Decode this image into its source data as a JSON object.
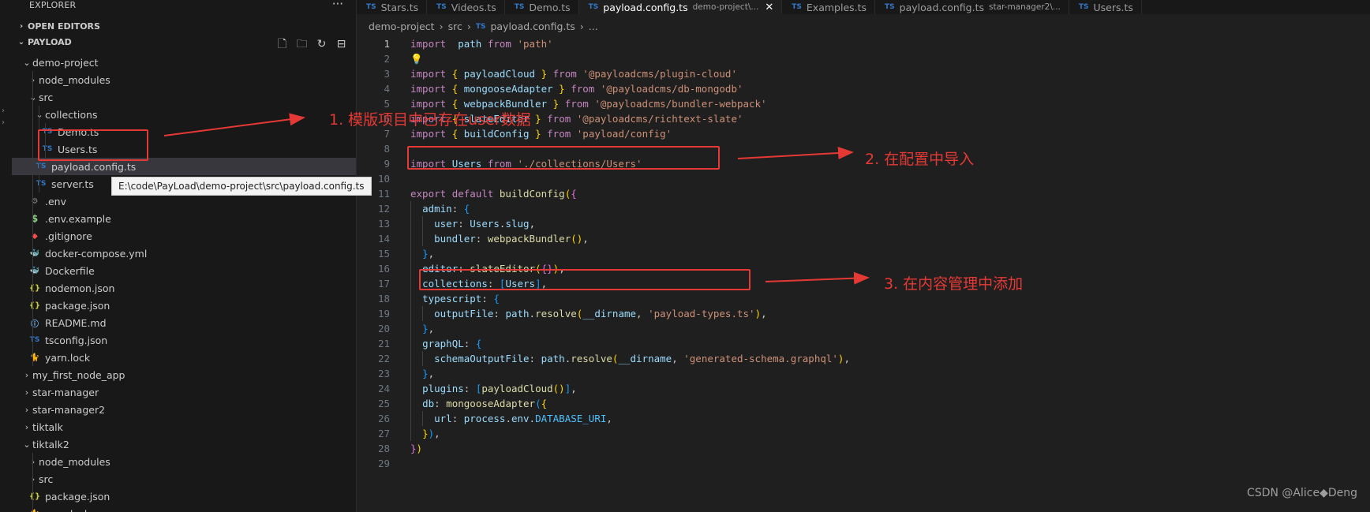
{
  "explorer": {
    "title": "EXPLORER",
    "more": "···",
    "open_editors": "OPEN EDITORS",
    "workspace": "PAYLOAD",
    "actions": [
      "new-file",
      "new-folder",
      "refresh",
      "collapse-all"
    ],
    "tree": [
      {
        "label": "demo-project",
        "type": "folder",
        "open": true,
        "depth": 1
      },
      {
        "label": "node_modules",
        "type": "folder",
        "open": false,
        "depth": 2
      },
      {
        "label": "src",
        "type": "folder",
        "open": true,
        "depth": 2
      },
      {
        "label": "collections",
        "type": "folder",
        "open": true,
        "depth": 3
      },
      {
        "label": "Demo.ts",
        "type": "ts",
        "depth": 4
      },
      {
        "label": "Users.ts",
        "type": "ts",
        "depth": 4
      },
      {
        "label": "payload.config.ts",
        "type": "ts",
        "depth": 3,
        "selected": true
      },
      {
        "label": "server.ts",
        "type": "ts",
        "depth": 3
      },
      {
        "label": ".env",
        "type": "env",
        "depth": 2
      },
      {
        "label": ".env.example",
        "type": "dollar",
        "depth": 2
      },
      {
        "label": ".gitignore",
        "type": "git",
        "depth": 2
      },
      {
        "label": "docker-compose.yml",
        "type": "docker",
        "depth": 2
      },
      {
        "label": "Dockerfile",
        "type": "docker",
        "depth": 2
      },
      {
        "label": "nodemon.json",
        "type": "json",
        "depth": 2
      },
      {
        "label": "package.json",
        "type": "json",
        "depth": 2
      },
      {
        "label": "README.md",
        "type": "info",
        "depth": 2
      },
      {
        "label": "tsconfig.json",
        "type": "ts",
        "depth": 2
      },
      {
        "label": "yarn.lock",
        "type": "yarn",
        "depth": 2
      },
      {
        "label": "my_first_node_app",
        "type": "folder",
        "open": false,
        "depth": 1
      },
      {
        "label": "star-manager",
        "type": "folder",
        "open": false,
        "depth": 1
      },
      {
        "label": "star-manager2",
        "type": "folder",
        "open": false,
        "depth": 1
      },
      {
        "label": "tiktalk",
        "type": "folder",
        "open": false,
        "depth": 1
      },
      {
        "label": "tiktalk2",
        "type": "folder",
        "open": true,
        "depth": 1
      },
      {
        "label": "node_modules",
        "type": "folder",
        "open": false,
        "depth": 2
      },
      {
        "label": "src",
        "type": "folder",
        "open": false,
        "depth": 2
      },
      {
        "label": "package.json",
        "type": "json",
        "depth": 2
      },
      {
        "label": "yarn.lock",
        "type": "yarn",
        "depth": 2
      }
    ],
    "tooltip": "E:\\code\\PayLoad\\demo-project\\src\\payload.config.ts"
  },
  "tabs": [
    {
      "label": "Stars.ts",
      "desc": "",
      "active": false
    },
    {
      "label": "Videos.ts",
      "desc": "",
      "active": false
    },
    {
      "label": "Demo.ts",
      "desc": "",
      "active": false
    },
    {
      "label": "payload.config.ts",
      "desc": "demo-project\\...",
      "active": true
    },
    {
      "label": "Examples.ts",
      "desc": "",
      "active": false
    },
    {
      "label": "payload.config.ts",
      "desc": "star-manager2\\...",
      "active": false
    },
    {
      "label": "Users.ts",
      "desc": "",
      "active": false
    }
  ],
  "breadcrumb": [
    "demo-project",
    "src",
    "payload.config.ts",
    "..."
  ],
  "code": [
    [
      [
        "kw",
        "import"
      ],
      [
        "",
        "  "
      ],
      [
        "var",
        "path"
      ],
      [
        "",
        " "
      ],
      [
        "kw",
        "from"
      ],
      [
        "",
        " "
      ],
      [
        "str",
        "'path'"
      ]
    ],
    [
      [
        "bulb",
        "💡"
      ]
    ],
    [
      [
        "kw",
        "import"
      ],
      [
        "",
        " "
      ],
      [
        "br1",
        "{"
      ],
      [
        "",
        " "
      ],
      [
        "var",
        "payloadCloud"
      ],
      [
        "",
        " "
      ],
      [
        "br1",
        "}"
      ],
      [
        "",
        " "
      ],
      [
        "kw",
        "from"
      ],
      [
        "",
        " "
      ],
      [
        "str",
        "'@payloadcms/plugin-cloud'"
      ]
    ],
    [
      [
        "kw",
        "import"
      ],
      [
        "",
        " "
      ],
      [
        "br1",
        "{"
      ],
      [
        "",
        " "
      ],
      [
        "var",
        "mongooseAdapter"
      ],
      [
        "",
        " "
      ],
      [
        "br1",
        "}"
      ],
      [
        "",
        " "
      ],
      [
        "kw",
        "from"
      ],
      [
        "",
        " "
      ],
      [
        "str",
        "'@payloadcms/db-mongodb'"
      ]
    ],
    [
      [
        "kw",
        "import"
      ],
      [
        "",
        " "
      ],
      [
        "br1",
        "{"
      ],
      [
        "",
        " "
      ],
      [
        "var",
        "webpackBundler"
      ],
      [
        "",
        " "
      ],
      [
        "br1",
        "}"
      ],
      [
        "",
        " "
      ],
      [
        "kw",
        "from"
      ],
      [
        "",
        " "
      ],
      [
        "str",
        "'@payloadcms/bundler-webpack'"
      ]
    ],
    [
      [
        "kw",
        "import"
      ],
      [
        "",
        " "
      ],
      [
        "br1",
        "{"
      ],
      [
        "",
        " "
      ],
      [
        "var",
        "slateEditor"
      ],
      [
        "",
        " "
      ],
      [
        "br1",
        "}"
      ],
      [
        "",
        " "
      ],
      [
        "kw",
        "from"
      ],
      [
        "",
        " "
      ],
      [
        "str",
        "'@payloadcms/richtext-slate'"
      ]
    ],
    [
      [
        "kw",
        "import"
      ],
      [
        "",
        " "
      ],
      [
        "br1",
        "{"
      ],
      [
        "",
        " "
      ],
      [
        "var",
        "buildConfig"
      ],
      [
        "",
        " "
      ],
      [
        "br1",
        "}"
      ],
      [
        "",
        " "
      ],
      [
        "kw",
        "from"
      ],
      [
        "",
        " "
      ],
      [
        "str",
        "'payload/config'"
      ]
    ],
    [],
    [
      [
        "kw",
        "import"
      ],
      [
        "",
        " "
      ],
      [
        "var",
        "Users"
      ],
      [
        "",
        " "
      ],
      [
        "kw",
        "from"
      ],
      [
        "",
        " "
      ],
      [
        "str",
        "'./collections/Users'"
      ]
    ],
    [],
    [
      [
        "kw",
        "export"
      ],
      [
        "",
        " "
      ],
      [
        "kw",
        "default"
      ],
      [
        "",
        " "
      ],
      [
        "fn",
        "buildConfig"
      ],
      [
        "br1",
        "("
      ],
      [
        "br2",
        "{"
      ]
    ],
    [
      [
        "",
        "  "
      ],
      [
        "var",
        "admin"
      ],
      [
        "",
        ": "
      ],
      [
        "br3",
        "{"
      ]
    ],
    [
      [
        "",
        "    "
      ],
      [
        "var",
        "user"
      ],
      [
        "",
        ": "
      ],
      [
        "var",
        "Users"
      ],
      [
        "",
        "."
      ],
      [
        "var",
        "slug"
      ],
      [
        "",
        ","
      ]
    ],
    [
      [
        "",
        "    "
      ],
      [
        "var",
        "bundler"
      ],
      [
        "",
        ": "
      ],
      [
        "fn",
        "webpackBundler"
      ],
      [
        "br1",
        "()"
      ],
      [
        "",
        ","
      ]
    ],
    [
      [
        "",
        "  "
      ],
      [
        "br3",
        "}"
      ],
      [
        "",
        ","
      ]
    ],
    [
      [
        "",
        "  "
      ],
      [
        "var",
        "editor"
      ],
      [
        "",
        ": "
      ],
      [
        "fn",
        "slateEditor"
      ],
      [
        "br1",
        "("
      ],
      [
        "br2",
        "{}"
      ],
      [
        "br1",
        ")"
      ],
      [
        "",
        ","
      ]
    ],
    [
      [
        "",
        "  "
      ],
      [
        "var",
        "collections"
      ],
      [
        "",
        ": "
      ],
      [
        "br3",
        "["
      ],
      [
        "var",
        "Users"
      ],
      [
        "br3",
        "]"
      ],
      [
        "",
        ","
      ]
    ],
    [
      [
        "",
        "  "
      ],
      [
        "var",
        "typescript"
      ],
      [
        "",
        ": "
      ],
      [
        "br3",
        "{"
      ]
    ],
    [
      [
        "",
        "    "
      ],
      [
        "var",
        "outputFile"
      ],
      [
        "",
        ": "
      ],
      [
        "var",
        "path"
      ],
      [
        "",
        "."
      ],
      [
        "fn",
        "resolve"
      ],
      [
        "br1",
        "("
      ],
      [
        "var",
        "__dirname"
      ],
      [
        "",
        ", "
      ],
      [
        "str",
        "'payload-types.ts'"
      ],
      [
        "br1",
        ")"
      ],
      [
        "",
        ","
      ]
    ],
    [
      [
        "",
        "  "
      ],
      [
        "br3",
        "}"
      ],
      [
        "",
        ","
      ]
    ],
    [
      [
        "",
        "  "
      ],
      [
        "var",
        "graphQL"
      ],
      [
        "",
        ": "
      ],
      [
        "br3",
        "{"
      ]
    ],
    [
      [
        "",
        "    "
      ],
      [
        "var",
        "schemaOutputFile"
      ],
      [
        "",
        ": "
      ],
      [
        "var",
        "path"
      ],
      [
        "",
        "."
      ],
      [
        "fn",
        "resolve"
      ],
      [
        "br1",
        "("
      ],
      [
        "var",
        "__dirname"
      ],
      [
        "",
        ", "
      ],
      [
        "str",
        "'generated-schema.graphql'"
      ],
      [
        "br1",
        ")"
      ],
      [
        "",
        ","
      ]
    ],
    [
      [
        "",
        "  "
      ],
      [
        "br3",
        "}"
      ],
      [
        "",
        ","
      ]
    ],
    [
      [
        "",
        "  "
      ],
      [
        "var",
        "plugins"
      ],
      [
        "",
        ": "
      ],
      [
        "br3",
        "["
      ],
      [
        "fn",
        "payloadCloud"
      ],
      [
        "br1",
        "()"
      ],
      [
        "br3",
        "]"
      ],
      [
        "",
        ","
      ]
    ],
    [
      [
        "",
        "  "
      ],
      [
        "var",
        "db"
      ],
      [
        "",
        ": "
      ],
      [
        "fn",
        "mongooseAdapter"
      ],
      [
        "br3",
        "("
      ],
      [
        "br1",
        "{"
      ]
    ],
    [
      [
        "",
        "    "
      ],
      [
        "var",
        "url"
      ],
      [
        "",
        ": "
      ],
      [
        "var",
        "process"
      ],
      [
        "",
        "."
      ],
      [
        "var",
        "env"
      ],
      [
        "",
        "."
      ],
      [
        "const",
        "DATABASE_URI"
      ],
      [
        "",
        ","
      ]
    ],
    [
      [
        "",
        "  "
      ],
      [
        "br1",
        "}"
      ],
      [
        "br3",
        ")"
      ],
      [
        "",
        ","
      ]
    ],
    [
      [
        "br2",
        "}"
      ],
      [
        "br1",
        ")"
      ]
    ],
    []
  ],
  "annotations": [
    {
      "text": "1. 模版项目中已存在user数据"
    },
    {
      "text": "2. 在配置中导入"
    },
    {
      "text": "3. 在内容管理中添加"
    }
  ],
  "watermark": "CSDN @Alice◆Deng",
  "colors": {
    "annotation": "#e53935",
    "ts_icon": "#3178c6",
    "keyword": "#c586c0",
    "string": "#ce9178",
    "variable": "#9cdcfe",
    "function": "#dcdcaa"
  }
}
